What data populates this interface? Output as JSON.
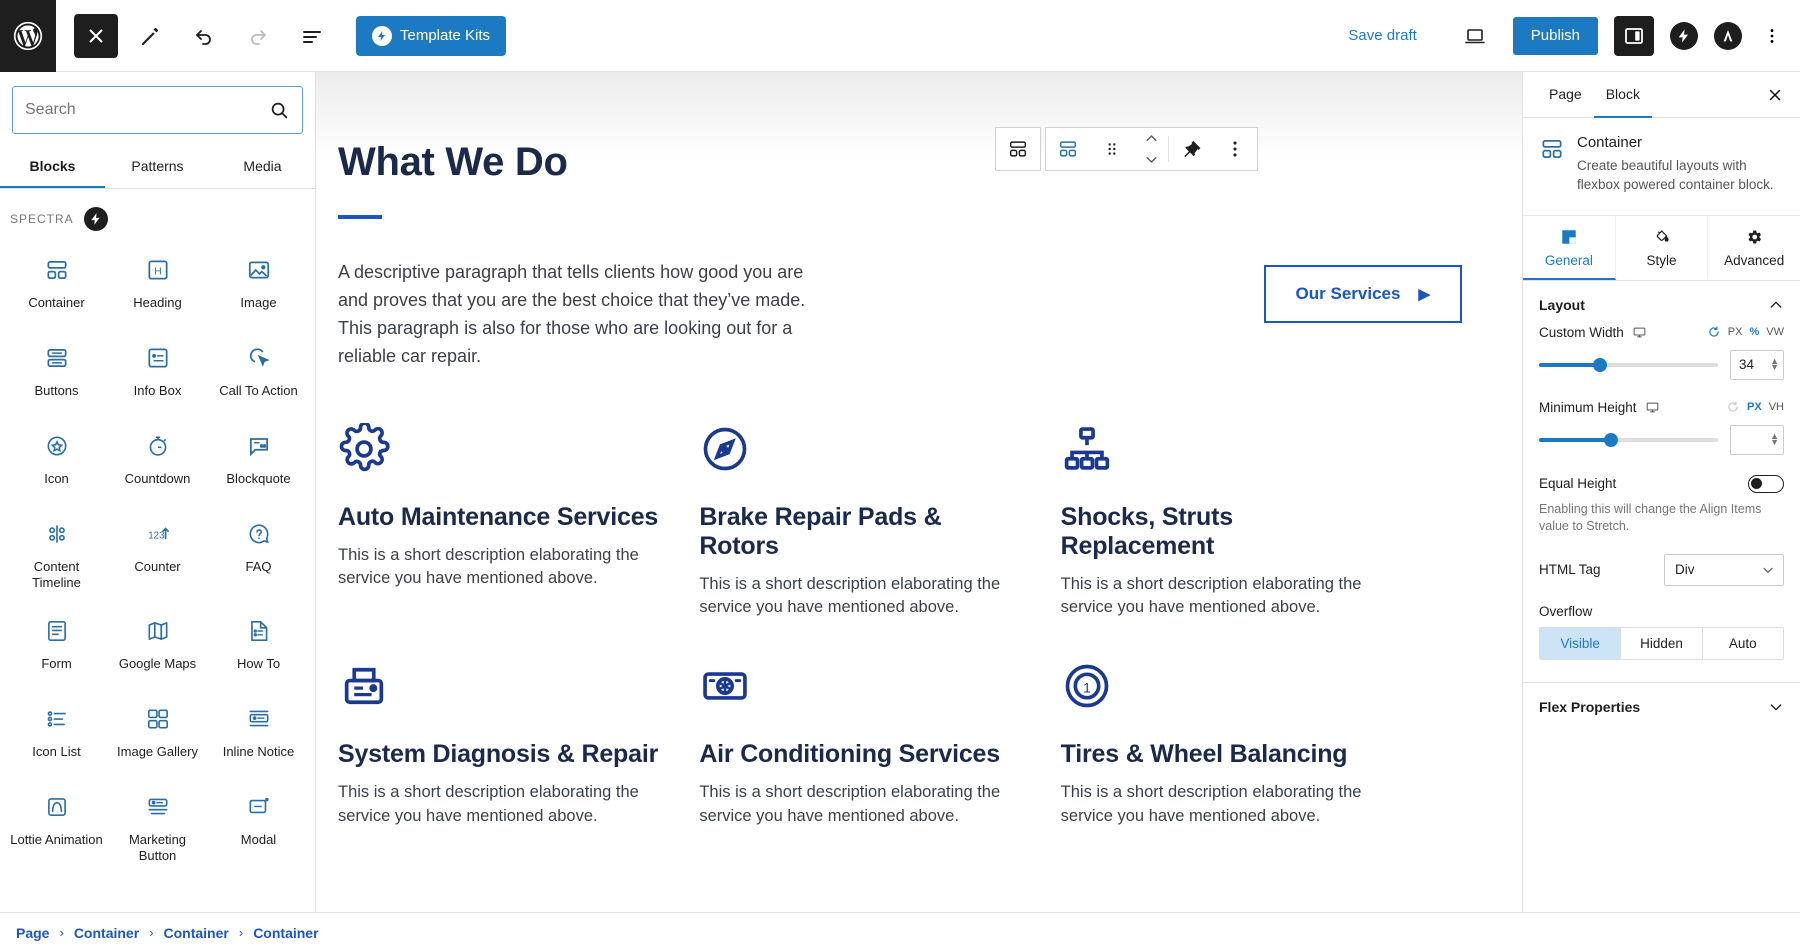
{
  "topbar": {
    "wp_logo_icon": "wordpress-logo-icon",
    "close_icon": "close-icon",
    "edit_icon": "pencil-icon",
    "undo_icon": "undo-icon",
    "redo_icon": "redo-icon",
    "list_view_icon": "list-view-icon",
    "template_kits_label": "Template Kits",
    "template_kits_icon": "spectra-bolt-icon",
    "save_draft_label": "Save draft",
    "preview_icon": "desktop-preview-icon",
    "publish_label": "Publish",
    "settings_sidebar_icon": "settings-sidebar-icon",
    "spectra_icon": "spectra-bolt-icon",
    "astra_icon": "astra-logo-icon",
    "options_icon": "kebab-menu-icon"
  },
  "inserter": {
    "search": {
      "value": "",
      "placeholder": "Search",
      "icon": "search-icon"
    },
    "tabs": [
      {
        "label": "Blocks",
        "active": true
      },
      {
        "label": "Patterns",
        "active": false
      },
      {
        "label": "Media",
        "active": false
      }
    ],
    "category": {
      "label": "SPECTRA",
      "icon": "spectra-bolt-icon"
    },
    "blocks": [
      {
        "label": "Container",
        "icon": "container-icon"
      },
      {
        "label": "Heading",
        "icon": "heading-icon"
      },
      {
        "label": "Image",
        "icon": "image-icon"
      },
      {
        "label": "Buttons",
        "icon": "buttons-icon"
      },
      {
        "label": "Info Box",
        "icon": "info-box-icon"
      },
      {
        "label": "Call To Action",
        "icon": "call-to-action-icon"
      },
      {
        "label": "Icon",
        "icon": "icon-star-icon"
      },
      {
        "label": "Countdown",
        "icon": "countdown-timer-icon"
      },
      {
        "label": "Blockquote",
        "icon": "blockquote-icon"
      },
      {
        "label": "Content Timeline",
        "icon": "content-timeline-icon"
      },
      {
        "label": "Counter",
        "icon": "counter-123-icon"
      },
      {
        "label": "FAQ",
        "icon": "faq-question-icon"
      },
      {
        "label": "Form",
        "icon": "form-icon"
      },
      {
        "label": "Google Maps",
        "icon": "google-maps-icon"
      },
      {
        "label": "How To",
        "icon": "how-to-icon"
      },
      {
        "label": "Icon List",
        "icon": "icon-list-icon"
      },
      {
        "label": "Image Gallery",
        "icon": "image-gallery-icon"
      },
      {
        "label": "Inline Notice",
        "icon": "inline-notice-icon"
      },
      {
        "label": "Lottie Animation",
        "icon": "lottie-animation-icon"
      },
      {
        "label": "Marketing Button",
        "icon": "marketing-button-icon"
      },
      {
        "label": "Modal",
        "icon": "modal-icon"
      }
    ]
  },
  "block_toolbar": {
    "parent_select_icon": "select-parent-container-icon",
    "block_type_icon": "container-block-icon",
    "drag_icon": "drag-handle-icon",
    "move_up_icon": "move-up-icon",
    "move_down_icon": "move-down-icon",
    "more_icon": "kebab-menu-icon",
    "toolbar_options_icon": "pin-toolbar-icon"
  },
  "canvas": {
    "heading": "What We Do",
    "paragraph": "A descriptive paragraph that tells clients how good you are and proves that you are the best choice that they’ve made. This paragraph is also for those who are looking out for a reliable car repair.",
    "cta_label": "Our Services",
    "cta_arrow": "▶",
    "services": [
      {
        "icon": "gear-cog-icon",
        "title": "Auto Maintenance Services",
        "desc": "This is a short description elaborating the service you have mentioned above."
      },
      {
        "icon": "compass-icon",
        "title": "Brake Repair Pads & Rotors",
        "desc": "This is a short description elaborating the service you have mentioned above."
      },
      {
        "icon": "sitemap-icon",
        "title": "Shocks, Struts Replacement",
        "desc": "This is a short description elaborating the service you have mentioned above."
      },
      {
        "icon": "diagnostic-machine-icon",
        "title": "System Diagnosis & Repair",
        "desc": "This is a short description elaborating the service you have mentioned above."
      },
      {
        "icon": "air-conditioner-icon",
        "title": "Air Conditioning Services",
        "desc": "This is a short description elaborating the service you have mentioned above."
      },
      {
        "icon": "tire-wheel-icon",
        "title": "Tires & Wheel Balancing",
        "desc": "This is a short description elaborating the service you have mentioned above."
      }
    ]
  },
  "settings": {
    "tabs": [
      {
        "label": "Page",
        "active": false
      },
      {
        "label": "Block",
        "active": true
      }
    ],
    "close_icon": "close-icon",
    "block": {
      "icon": "container-block-icon",
      "name": "Container",
      "description": "Create beautiful layouts with flexbox powered container block."
    },
    "gsa_tabs": [
      {
        "label": "General",
        "icon": "general-layout-icon",
        "active": true
      },
      {
        "label": "Style",
        "icon": "paint-bucket-icon",
        "active": false
      },
      {
        "label": "Advanced",
        "icon": "gear-icon",
        "active": false
      }
    ],
    "layout": {
      "title": "Layout",
      "collapse_icon": "chevron-up-icon",
      "custom_width": {
        "label": "Custom Width",
        "device_icon": "desktop-icon",
        "reset_icon": "reset-icon",
        "units": [
          {
            "label": "PX",
            "active": false
          },
          {
            "label": "%",
            "active": true
          },
          {
            "label": "VW",
            "active": false
          }
        ],
        "value": "34",
        "slider_percent": 34
      },
      "minimum_height": {
        "label": "Minimum Height",
        "device_icon": "desktop-icon",
        "reset_icon": "reset-icon",
        "units": [
          {
            "label": "PX",
            "active": true
          },
          {
            "label": "VH",
            "active": false
          }
        ],
        "value": "",
        "slider_percent": 40
      },
      "equal_height": {
        "label": "Equal Height",
        "enabled": false,
        "help": "Enabling this will change the Align Items value to Stretch."
      },
      "html_tag": {
        "label": "HTML Tag",
        "value": "Div",
        "chevron_icon": "chevron-down-icon"
      },
      "overflow": {
        "label": "Overflow",
        "options": [
          {
            "label": "Visible",
            "active": true
          },
          {
            "label": "Hidden",
            "active": false
          },
          {
            "label": "Auto",
            "active": false
          }
        ]
      }
    },
    "flex_properties": {
      "title": "Flex Properties",
      "collapse_icon": "chevron-down-icon"
    }
  },
  "breadcrumb": {
    "separator": "›",
    "items": [
      {
        "label": "Page"
      },
      {
        "label": "Container"
      },
      {
        "label": "Container"
      },
      {
        "label": "Container"
      }
    ]
  },
  "colors": {
    "accent": "#1b7ac2",
    "brand_blue": "#1b56c4",
    "heading_navy": "#1b2a4a",
    "dark": "#1e1e1e"
  }
}
